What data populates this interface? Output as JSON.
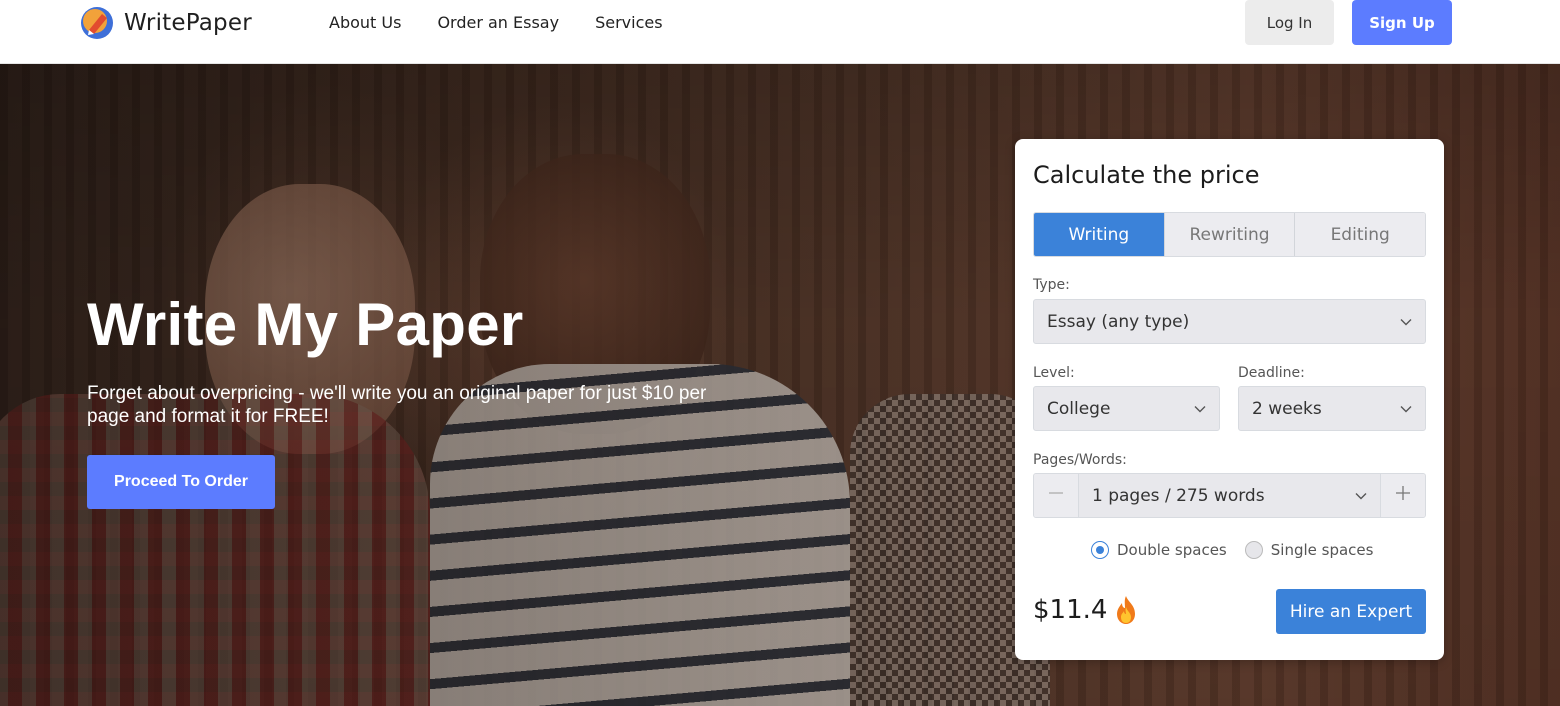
{
  "header": {
    "logo_text": "WritePaper",
    "nav": [
      "About Us",
      "Order an Essay",
      "Services"
    ],
    "login_label": "Log In",
    "signup_label": "Sign Up"
  },
  "hero": {
    "title": "Write My Paper",
    "subtitle": "Forget about overpricing - we'll write you an original paper for just $10 per page and format it for FREE!",
    "cta_label": "Proceed To Order"
  },
  "calculator": {
    "title": "Calculate the price",
    "tabs": [
      {
        "label": "Writing",
        "active": true
      },
      {
        "label": "Rewriting",
        "active": false
      },
      {
        "label": "Editing",
        "active": false
      }
    ],
    "type_label": "Type:",
    "type_value": "Essay (any type)",
    "level_label": "Level:",
    "level_value": "College",
    "deadline_label": "Deadline:",
    "deadline_value": "2 weeks",
    "pages_label": "Pages/Words:",
    "pages_value": "1 pages / 275 words",
    "spacing": [
      {
        "label": "Double spaces",
        "selected": true
      },
      {
        "label": "Single spaces",
        "selected": false
      }
    ],
    "price": "$11.4",
    "hire_label": "Hire an Expert"
  },
  "colors": {
    "primary_button": "#5c7cff",
    "calculator_accent": "#3b82d9"
  },
  "icons": [
    "logo-icon",
    "chevron-down-icon",
    "minus-icon",
    "plus-icon",
    "fire-icon"
  ]
}
